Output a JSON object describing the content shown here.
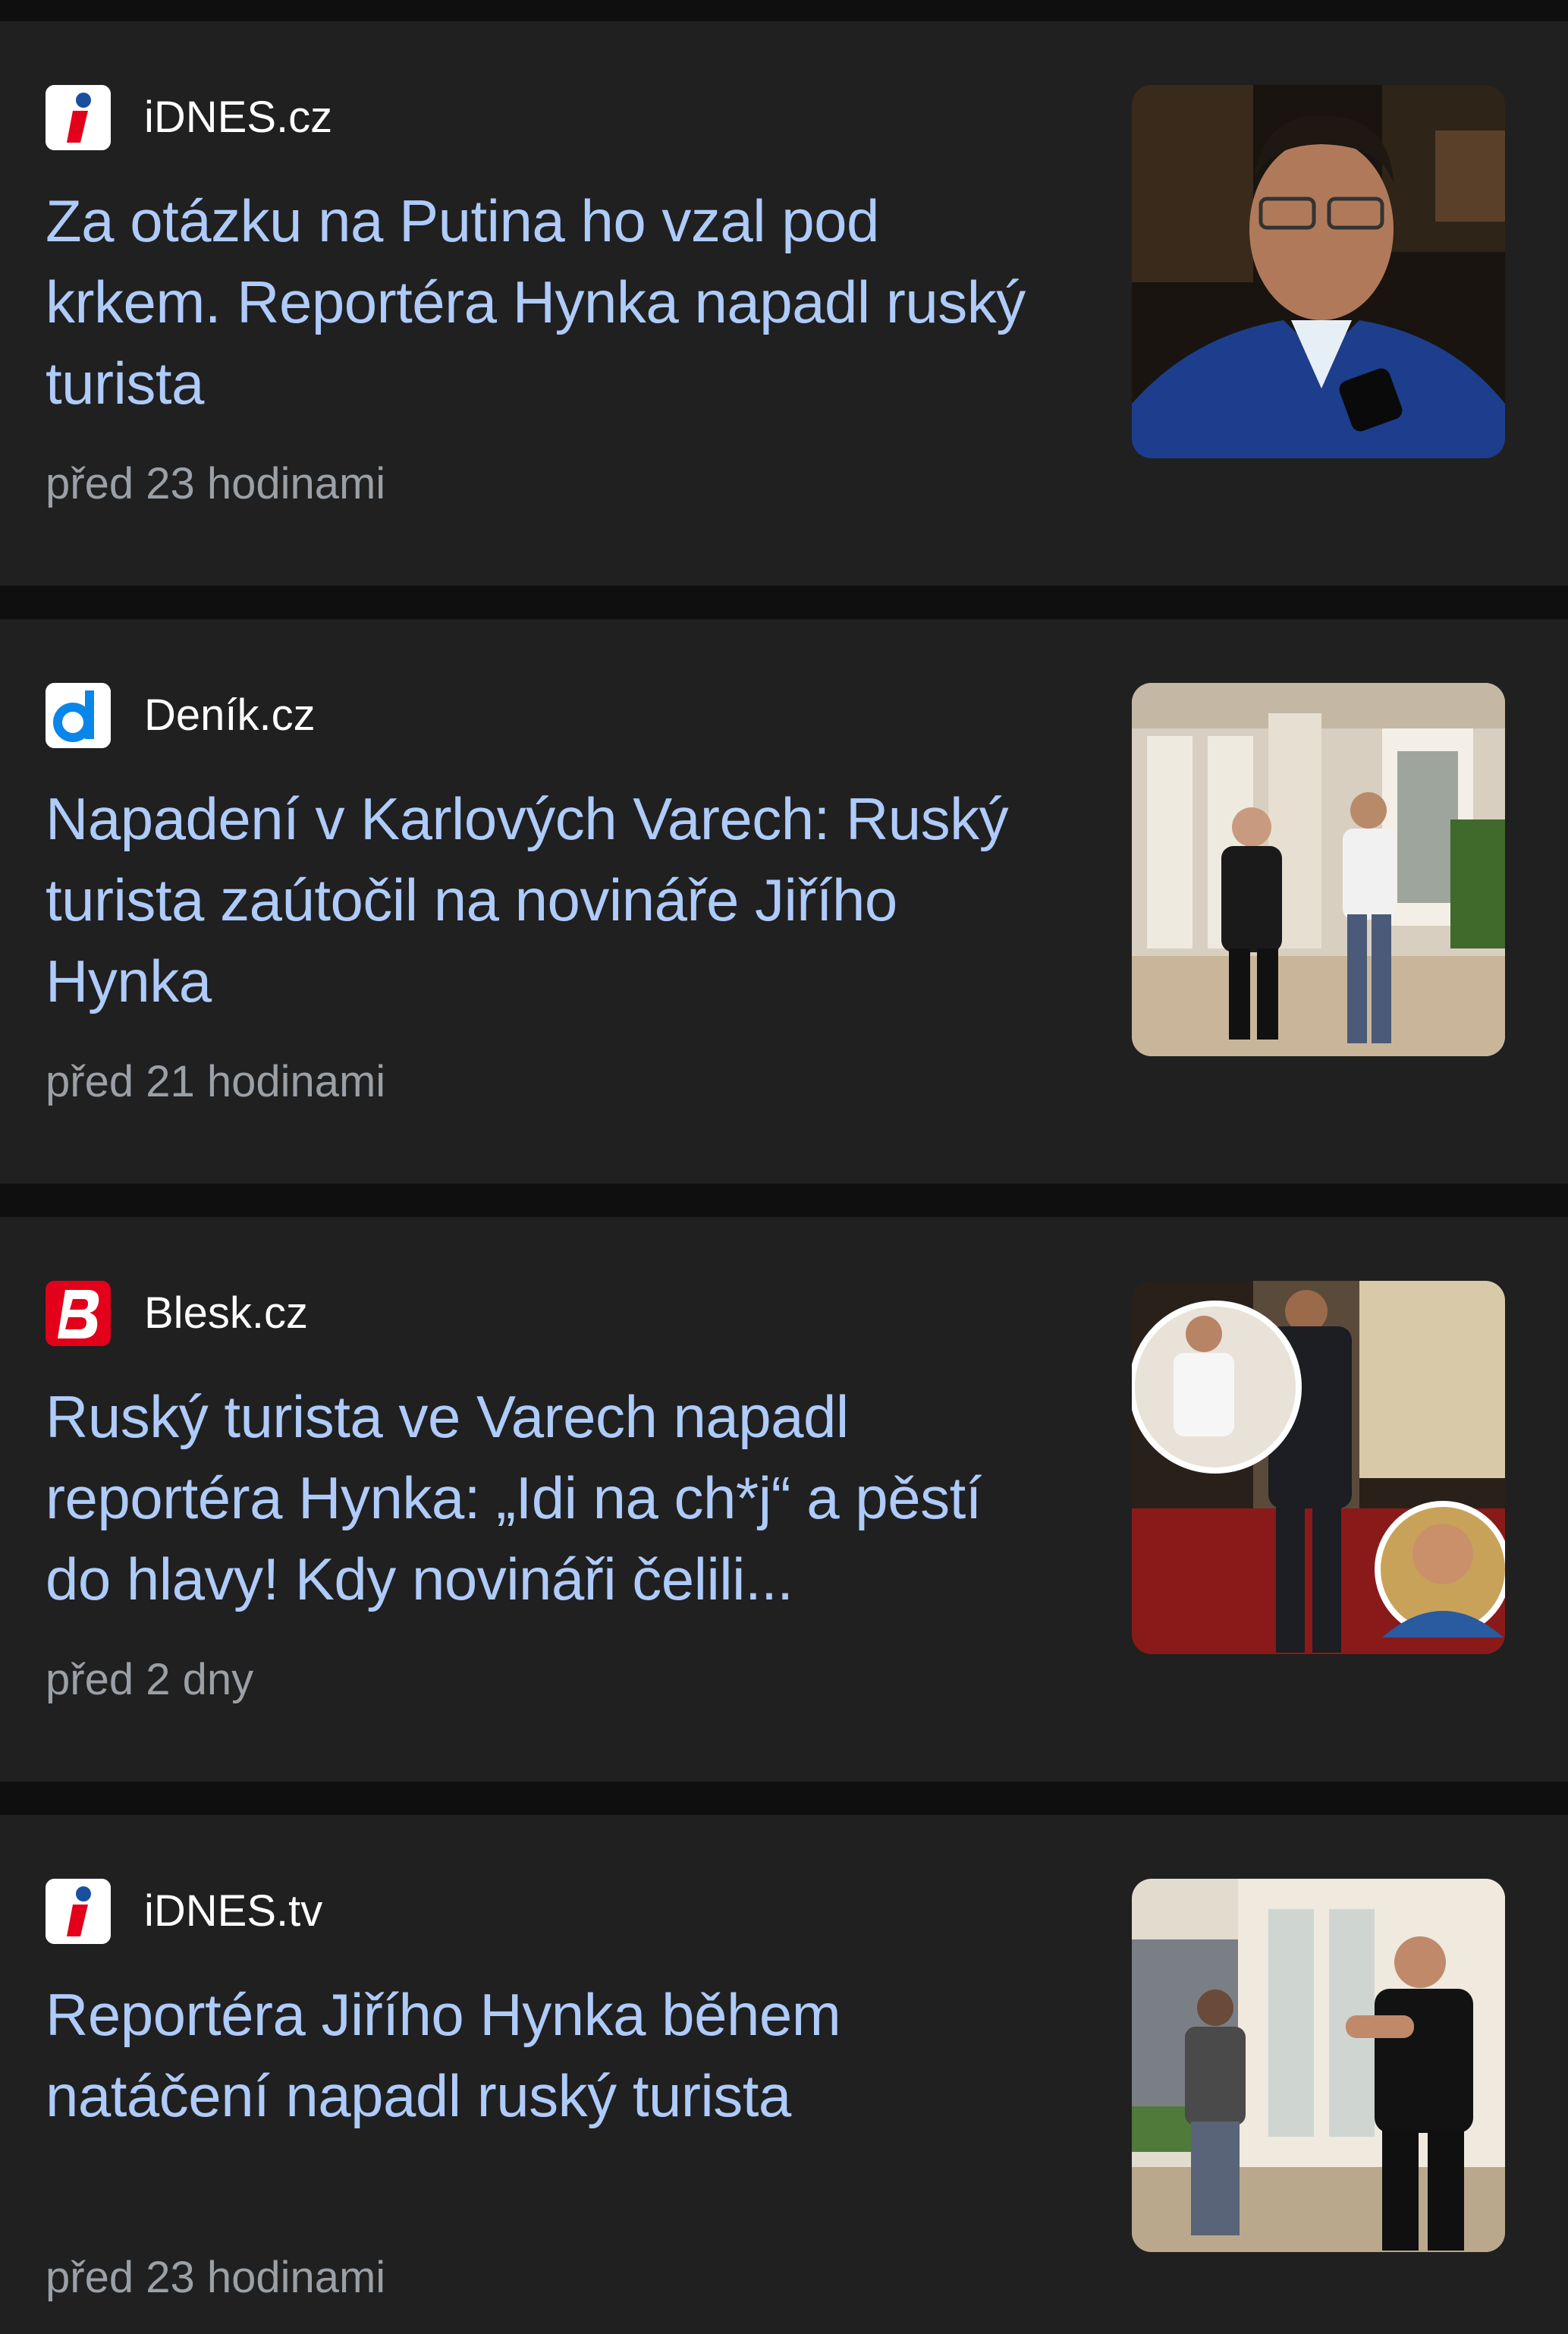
{
  "articles": [
    {
      "source": "iDNES.cz",
      "favicon": "idnes-favicon-icon",
      "headline": "Za otázku na Putina ho vzal pod krkem. Reportéra Hynka napadl ruský turista",
      "time": "před 23 hodinami"
    },
    {
      "source": "Deník.cz",
      "favicon": "denik-favicon-icon",
      "headline": "Napadení v Karlových Varech: Ruský turista zaútočil na novináře Jiřího Hynka",
      "time": "před 21 hodinami"
    },
    {
      "source": "Blesk.cz",
      "favicon": "blesk-favicon-icon",
      "headline": "Ruský turista ve Varech napadl reportéra Hynka: „Idi na ch*j“ a pěstí do hlavy! Kdy novináři čelili...",
      "time": "před 2 dny"
    },
    {
      "source": "iDNES.tv",
      "favicon": "idnes-favicon-icon",
      "headline": "Reportéra Jiřího Hynka během natáčení napadl ruský turista",
      "time": "před 23 hodinami"
    }
  ],
  "colors": {
    "page_background": "#0f0f0f",
    "card_background": "#202020",
    "headline": "#aecbfa",
    "source": "#ffffff",
    "timestamp": "#9aa0a6",
    "idnes_red": "#e3001b",
    "denik_blue": "#0a86ea",
    "blesk_red": "#e2001a"
  }
}
